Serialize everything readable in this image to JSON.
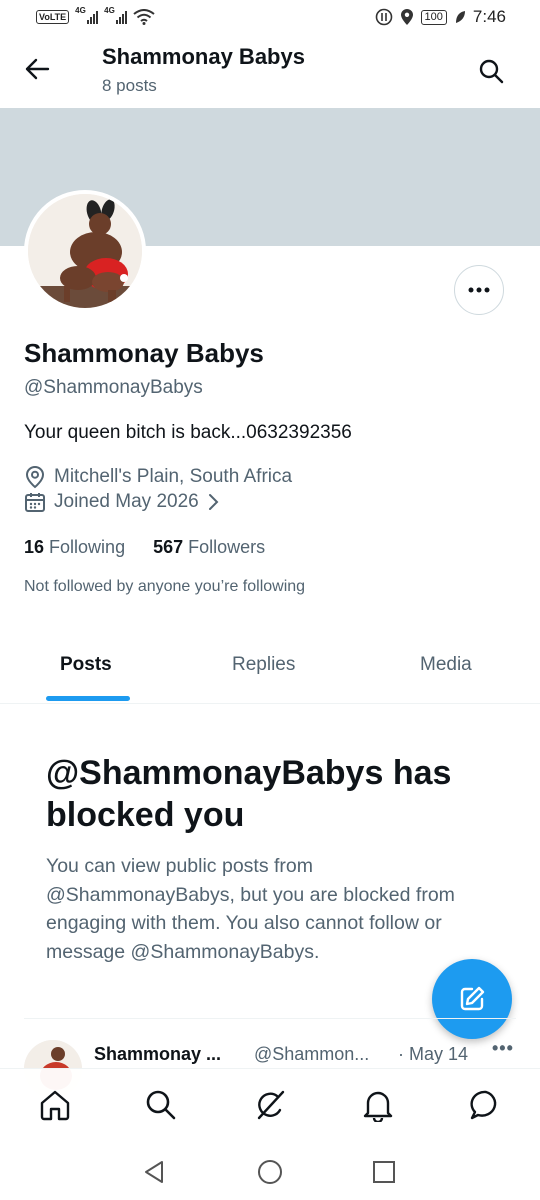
{
  "status_bar": {
    "volte": "VoLTE",
    "signal1_label": "4G",
    "signal2_label": "4G",
    "battery": "100",
    "time": "7:46"
  },
  "header": {
    "title": "Shammonay Babys",
    "subtitle": "8 posts"
  },
  "profile": {
    "name": "Shammonay Babys",
    "handle": "@ShammonayBabys",
    "bio": "Your queen bitch is back...0632392356",
    "location": "Mitchell's Plain, South Africa",
    "joined": "Joined May 2026",
    "following_count": "16",
    "following_label": "Following",
    "followers_count": "567",
    "followers_label": "Followers",
    "not_followed": "Not followed by anyone you’re following"
  },
  "tabs": [
    {
      "label": "Posts",
      "active": true
    },
    {
      "label": "Replies",
      "active": false
    },
    {
      "label": "Media",
      "active": false
    }
  ],
  "blocked": {
    "title": "@ShammonayBabys has blocked you",
    "description": "You can view public posts from @ShammonayBabys, but you are blocked from engaging with them. You also cannot follow or message @ShammonayBabys."
  },
  "post_preview": {
    "name": "Shammonay ...",
    "handle": "@Shammon...",
    "date": "· May 14",
    "more": "•••"
  },
  "colors": {
    "accent": "#1d9bf0",
    "banner": "#cfd9de",
    "secondary_text": "#536471"
  }
}
